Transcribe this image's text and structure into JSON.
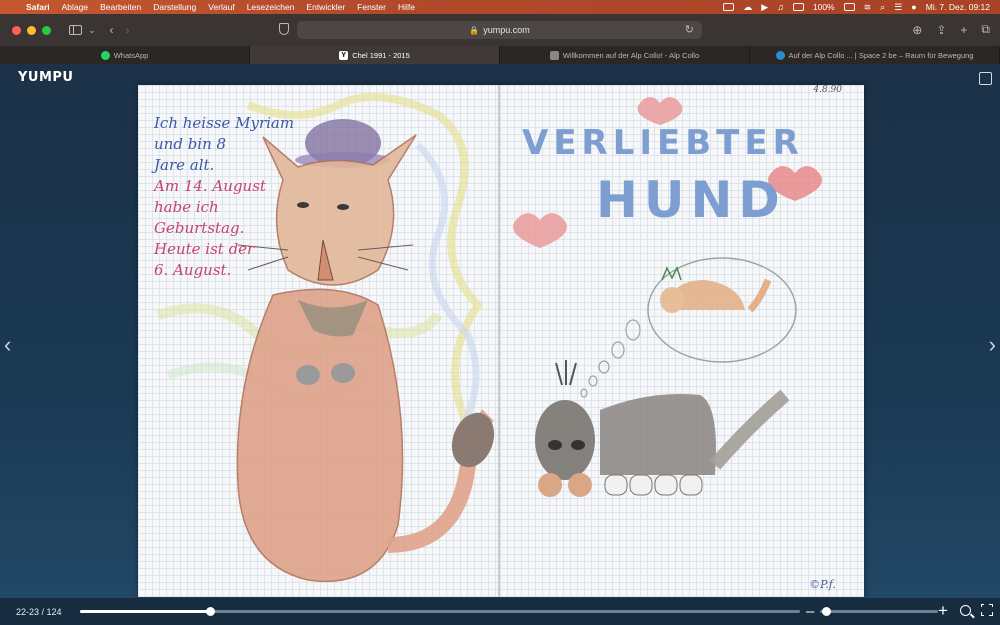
{
  "menubar": {
    "items": [
      "Safari",
      "Ablage",
      "Bearbeiten",
      "Darstellung",
      "Verlauf",
      "Lesezeichen",
      "Entwickler",
      "Fenster",
      "Hilfe"
    ],
    "battery": "100%",
    "datetime": "Mi. 7. Dez.  09:12"
  },
  "toolbar": {
    "url": "yumpu.com"
  },
  "tabs": [
    {
      "label": "WhatsApp",
      "icon": "whatsapp-icon"
    },
    {
      "label": "Chel 1991 - 2015",
      "icon": "yumpu-icon"
    },
    {
      "label": "Willkommen auf der Alp Collo! - Alp Collo",
      "icon": "site-icon"
    },
    {
      "label": "Auf der Alp Collo ... | Space 2 be – Raum für Bewegung",
      "icon": "wordpress-icon"
    }
  ],
  "viewer": {
    "brand": "YUMPU",
    "left_page": {
      "lines_blue": [
        "Ich heisse Myriam",
        "und bin 8",
        "Jare alt."
      ],
      "lines_red": [
        "Am 14. August",
        "habe ich",
        "Geburtstag.",
        "Heute ist der",
        "6. August."
      ]
    },
    "right_page": {
      "date": "4.8.90",
      "title_line1": "VERLIEBTER",
      "title_line2": "HUND",
      "signature": "©P.f."
    },
    "page_indicator": "22-23 / 124",
    "progress_fraction": 0.18,
    "zoom_fraction": 0.05
  },
  "colors": {
    "menubar": "#b2492b",
    "viewer_bg": "#1c3147",
    "title_blue": "#7d9ed0",
    "text_red": "#c5456d",
    "text_blue": "#3c58a6"
  }
}
